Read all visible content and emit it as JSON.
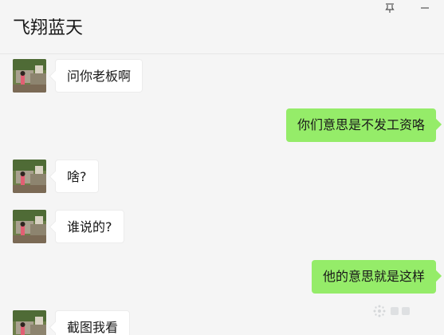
{
  "window": {
    "title": "飞翔蓝天",
    "pin_icon": "pin-icon",
    "minimize_icon": "minimize-icon"
  },
  "colors": {
    "background": "#f5f5f5",
    "incoming_bubble": "#ffffff",
    "outgoing_bubble": "#95ec69",
    "text": "#191919"
  },
  "messages": [
    {
      "side": "left",
      "text": "问你老板啊",
      "avatar": "contact-avatar"
    },
    {
      "side": "right",
      "text": "你们意思是不发工资咯"
    },
    {
      "side": "left",
      "text": "啥?",
      "avatar": "contact-avatar"
    },
    {
      "side": "left",
      "text": "谁说的?",
      "avatar": "contact-avatar"
    },
    {
      "side": "right",
      "text": "他的意思就是这样"
    },
    {
      "side": "left",
      "text": "截图我看",
      "avatar": "contact-avatar"
    }
  ],
  "watermark_icon": "watermark-logo"
}
